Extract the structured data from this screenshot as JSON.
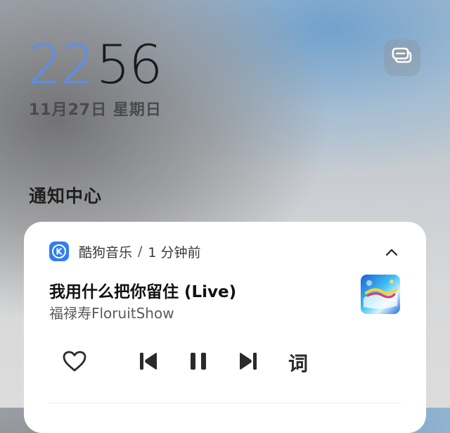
{
  "lockscreen": {
    "clock_hour": "22",
    "clock_minute": "56",
    "date": "11月27日 星期日",
    "notification_center_title": "通知中心",
    "manage_icon": "notification-manage-icon"
  },
  "notification": {
    "app_name": "酷狗音乐",
    "separator": "/",
    "time_ago": "1 分钟前",
    "app_icon": "kugou-k-icon",
    "app_icon_letter": "K",
    "song_title": "我用什么把你留住 (Live)",
    "artist": "福禄寿FloruitShow",
    "controls": {
      "like_icon": "heart-icon",
      "prev_icon": "skip-previous-icon",
      "pause_icon": "pause-icon",
      "next_icon": "skip-next-icon",
      "lyrics_label": "词"
    },
    "collapse_icon": "chevron-up-icon"
  },
  "colors": {
    "clock_hour": "#5a90ec",
    "clock_minute": "#1b1b1b",
    "app_icon_bg": "#2f7ef0"
  }
}
